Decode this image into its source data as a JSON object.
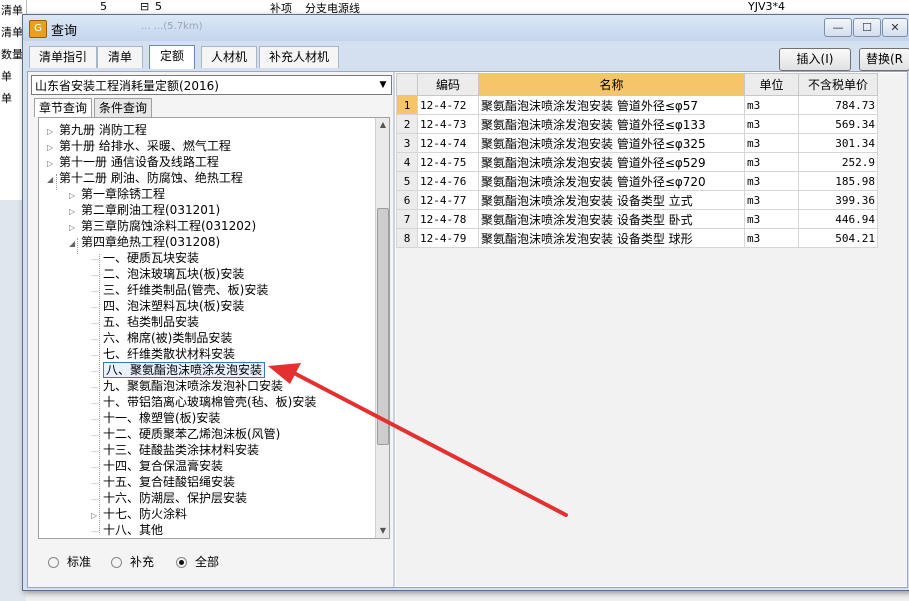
{
  "background_app": {
    "left_items": [
      "清单",
      "清单",
      "数量",
      "单",
      "单"
    ],
    "top_row_num": "5",
    "top_row_code": "5",
    "top_row_type": "补项",
    "top_row_name": "分支电源线",
    "top_row_spec": "YJV3*4",
    "faint_text": "...  ...(5.7km)"
  },
  "dialog": {
    "title": "查询",
    "minimize": "—",
    "maximize": "☐",
    "close": "✕"
  },
  "tabs": [
    "清单指引",
    "清单",
    "定额",
    "人材机",
    "补充人材机"
  ],
  "active_tab": 2,
  "buttons": {
    "insert": "插入(I)",
    "replace": "替换(R"
  },
  "left_panel": {
    "quota_library": "山东省安装工程消耗量定额(2016)",
    "subtabs": [
      "章节查询",
      "条件查询"
    ],
    "tree": [
      {
        "label": "第九册 消防工程",
        "expand": "▷"
      },
      {
        "label": "第十册 给排水、采暖、燃气工程",
        "expand": "▷"
      },
      {
        "label": "第十一册 通信设备及线路工程",
        "expand": "▷"
      },
      {
        "label": "第十二册 刷油、防腐蚀、绝热工程",
        "expand": "◢"
      },
      {
        "label": "第一章除锈工程",
        "expand": "▷"
      },
      {
        "label": "第二章刷油工程(031201)",
        "expand": "▷"
      },
      {
        "label": "第三章防腐蚀涂料工程(031202)",
        "expand": "▷"
      },
      {
        "label": "第四章绝热工程(031208)",
        "expand": "◢"
      },
      {
        "label": "一、硬质瓦块安装",
        "expand": ""
      },
      {
        "label": "二、泡沫玻璃瓦块(板)安装",
        "expand": ""
      },
      {
        "label": "三、纤维类制品(管壳、板)安装",
        "expand": ""
      },
      {
        "label": "四、泡沫塑料瓦块(板)安装",
        "expand": ""
      },
      {
        "label": "五、毡类制品安装",
        "expand": ""
      },
      {
        "label": "六、棉席(被)类制品安装",
        "expand": ""
      },
      {
        "label": "七、纤维类散状材料安装",
        "expand": ""
      },
      {
        "label": "八、聚氨酯泡沫喷涂发泡安装",
        "expand": "",
        "selected": true
      },
      {
        "label": "九、聚氨酯泡沫喷涂发泡补口安装",
        "expand": ""
      },
      {
        "label": "十、带铝箔离心玻璃棉管壳(毡、板)安装",
        "expand": ""
      },
      {
        "label": "十一、橡塑管(板)安装",
        "expand": ""
      },
      {
        "label": "十二、硬质聚苯乙烯泡沫板(风管)",
        "expand": ""
      },
      {
        "label": "十三、硅酸盐类涂抹材料安装",
        "expand": ""
      },
      {
        "label": "十四、复合保温膏安装",
        "expand": ""
      },
      {
        "label": "十五、复合硅酸铝绳安装",
        "expand": ""
      },
      {
        "label": "十六、防潮层、保护层安装",
        "expand": ""
      },
      {
        "label": "十七、防火涂料",
        "expand": "▷"
      },
      {
        "label": "十八、其他",
        "expand": ""
      }
    ],
    "radios": [
      {
        "label": "标准",
        "checked": false
      },
      {
        "label": "补充",
        "checked": false
      },
      {
        "label": "全部",
        "checked": true
      }
    ]
  },
  "table": {
    "headers": [
      "编码",
      "名称",
      "单位",
      "不含税单价"
    ],
    "rows": [
      {
        "num": "1",
        "code": "12-4-72",
        "name": "聚氨酯泡沫喷涂发泡安装 管道外径≤φ57",
        "unit": "m3",
        "price": "784.73"
      },
      {
        "num": "2",
        "code": "12-4-73",
        "name": "聚氨酯泡沫喷涂发泡安装 管道外径≤φ133",
        "unit": "m3",
        "price": "569.34"
      },
      {
        "num": "3",
        "code": "12-4-74",
        "name": "聚氨酯泡沫喷涂发泡安装 管道外径≤φ325",
        "unit": "m3",
        "price": "301.34"
      },
      {
        "num": "4",
        "code": "12-4-75",
        "name": "聚氨酯泡沫喷涂发泡安装 管道外径≤φ529",
        "unit": "m3",
        "price": "252.9"
      },
      {
        "num": "5",
        "code": "12-4-76",
        "name": "聚氨酯泡沫喷涂发泡安装 管道外径≤φ720",
        "unit": "m3",
        "price": "185.98"
      },
      {
        "num": "6",
        "code": "12-4-77",
        "name": "聚氨酯泡沫喷涂发泡安装 设备类型 立式",
        "unit": "m3",
        "price": "399.36"
      },
      {
        "num": "7",
        "code": "12-4-78",
        "name": "聚氨酯泡沫喷涂发泡安装 设备类型 卧式",
        "unit": "m3",
        "price": "446.94"
      },
      {
        "num": "8",
        "code": "12-4-79",
        "name": "聚氨酯泡沫喷涂发泡安装 设备类型 球形",
        "unit": "m3",
        "price": "504.21"
      }
    ]
  },
  "colors": {
    "header_highlight": "#f6c56a",
    "arrow": "#e53030",
    "selection_border": "#3b75c5"
  }
}
